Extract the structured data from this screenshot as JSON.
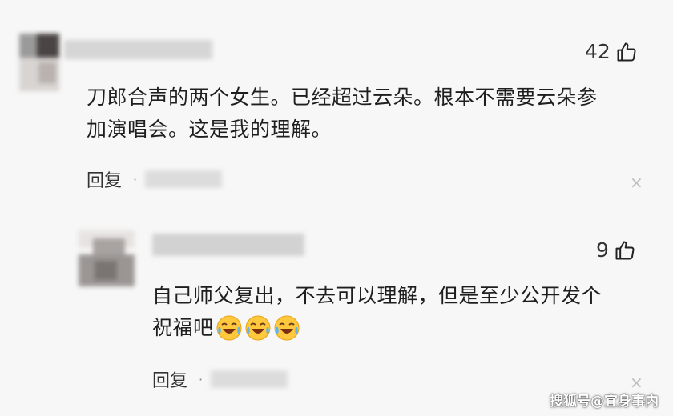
{
  "comments": [
    {
      "likes": "42",
      "text_line1": "刀郎合声的两个女生。已经超过云朵。根本不需要云朵参",
      "text_line2": "加演唱会。这是我的理解。",
      "reply_label": "回复",
      "dot": "·",
      "close": "×"
    },
    {
      "likes": "9",
      "text_line1": "自己师父复出，不去可以理解，但是至少公开发个",
      "text_line2": "祝福吧",
      "reply_label": "回复",
      "dot": "·",
      "close": "×"
    }
  ],
  "icons": {
    "like": "thumbs-up-icon",
    "emoji": "laughing-crying-emoji",
    "close": "close-icon"
  },
  "watermark": "搜狐号@宜身事内",
  "colors": {
    "background": "#f7f7f7",
    "text": "#1e1e1e",
    "muted": "#888888"
  }
}
